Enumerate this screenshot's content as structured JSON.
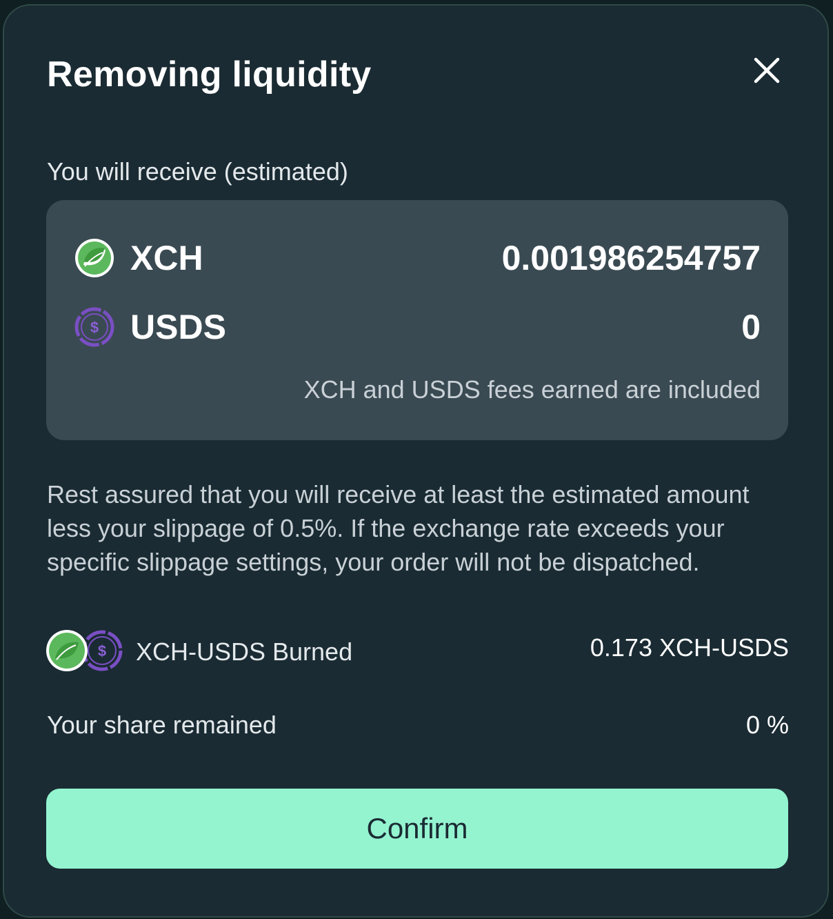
{
  "modal": {
    "title": "Removing liquidity",
    "close_icon": "close-icon",
    "subtitle": "You will receive (estimated)"
  },
  "receive": {
    "tokens": [
      {
        "symbol": "XCH",
        "amount": "0.001986254757",
        "icon": "chia-leaf-icon",
        "color": "#5cb85c"
      },
      {
        "symbol": "USDS",
        "amount": "0",
        "icon": "usds-dollar-icon",
        "color": "#7a4fc4"
      }
    ],
    "fees_note": "XCH and USDS fees earned are included"
  },
  "info": {
    "text": "Rest assured that you will receive at least the estimated amount less your slippage of 0.5%. If the exchange rate exceeds your specific slippage settings, your order will not be dispatched."
  },
  "burn": {
    "label": "XCH-USDS Burned",
    "value": "0.173 XCH-USDS"
  },
  "share": {
    "label": "Your share remained",
    "value": "0 %"
  },
  "confirm": {
    "label": "Confirm",
    "color": "#94f4d0"
  }
}
